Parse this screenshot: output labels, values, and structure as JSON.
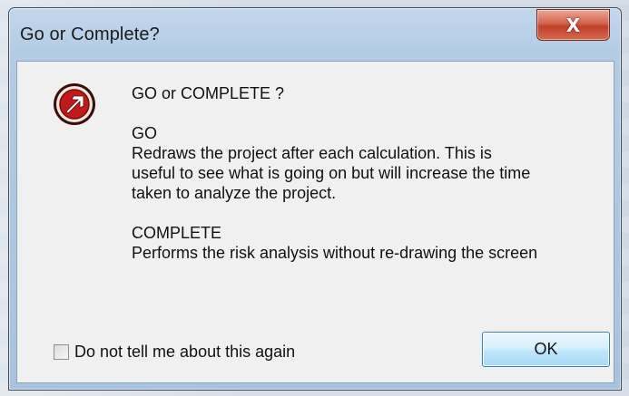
{
  "window": {
    "title": "Go or Complete?",
    "close_symbol": "X"
  },
  "message": {
    "question": "GO or COMPLETE ?",
    "go_heading": "GO",
    "go_description_lines": [
      "Redraws the project after each calculation. This is",
      "useful to see what is going on but will increase the time",
      "taken to analyze the project."
    ],
    "complete_heading": "COMPLETE",
    "complete_description": "Performs the risk analysis without re-drawing the screen"
  },
  "dont_tell_again": {
    "label": "Do not tell me about this again",
    "checked": false
  },
  "buttons": {
    "ok_label": "OK"
  },
  "icons": {
    "dialog_icon": "red-arrow-circle-icon",
    "close_icon": "close-icon"
  },
  "colors": {
    "close_button": "#d5634c",
    "icon_red": "#c0191c",
    "ok_border": "#3c7fb1"
  }
}
